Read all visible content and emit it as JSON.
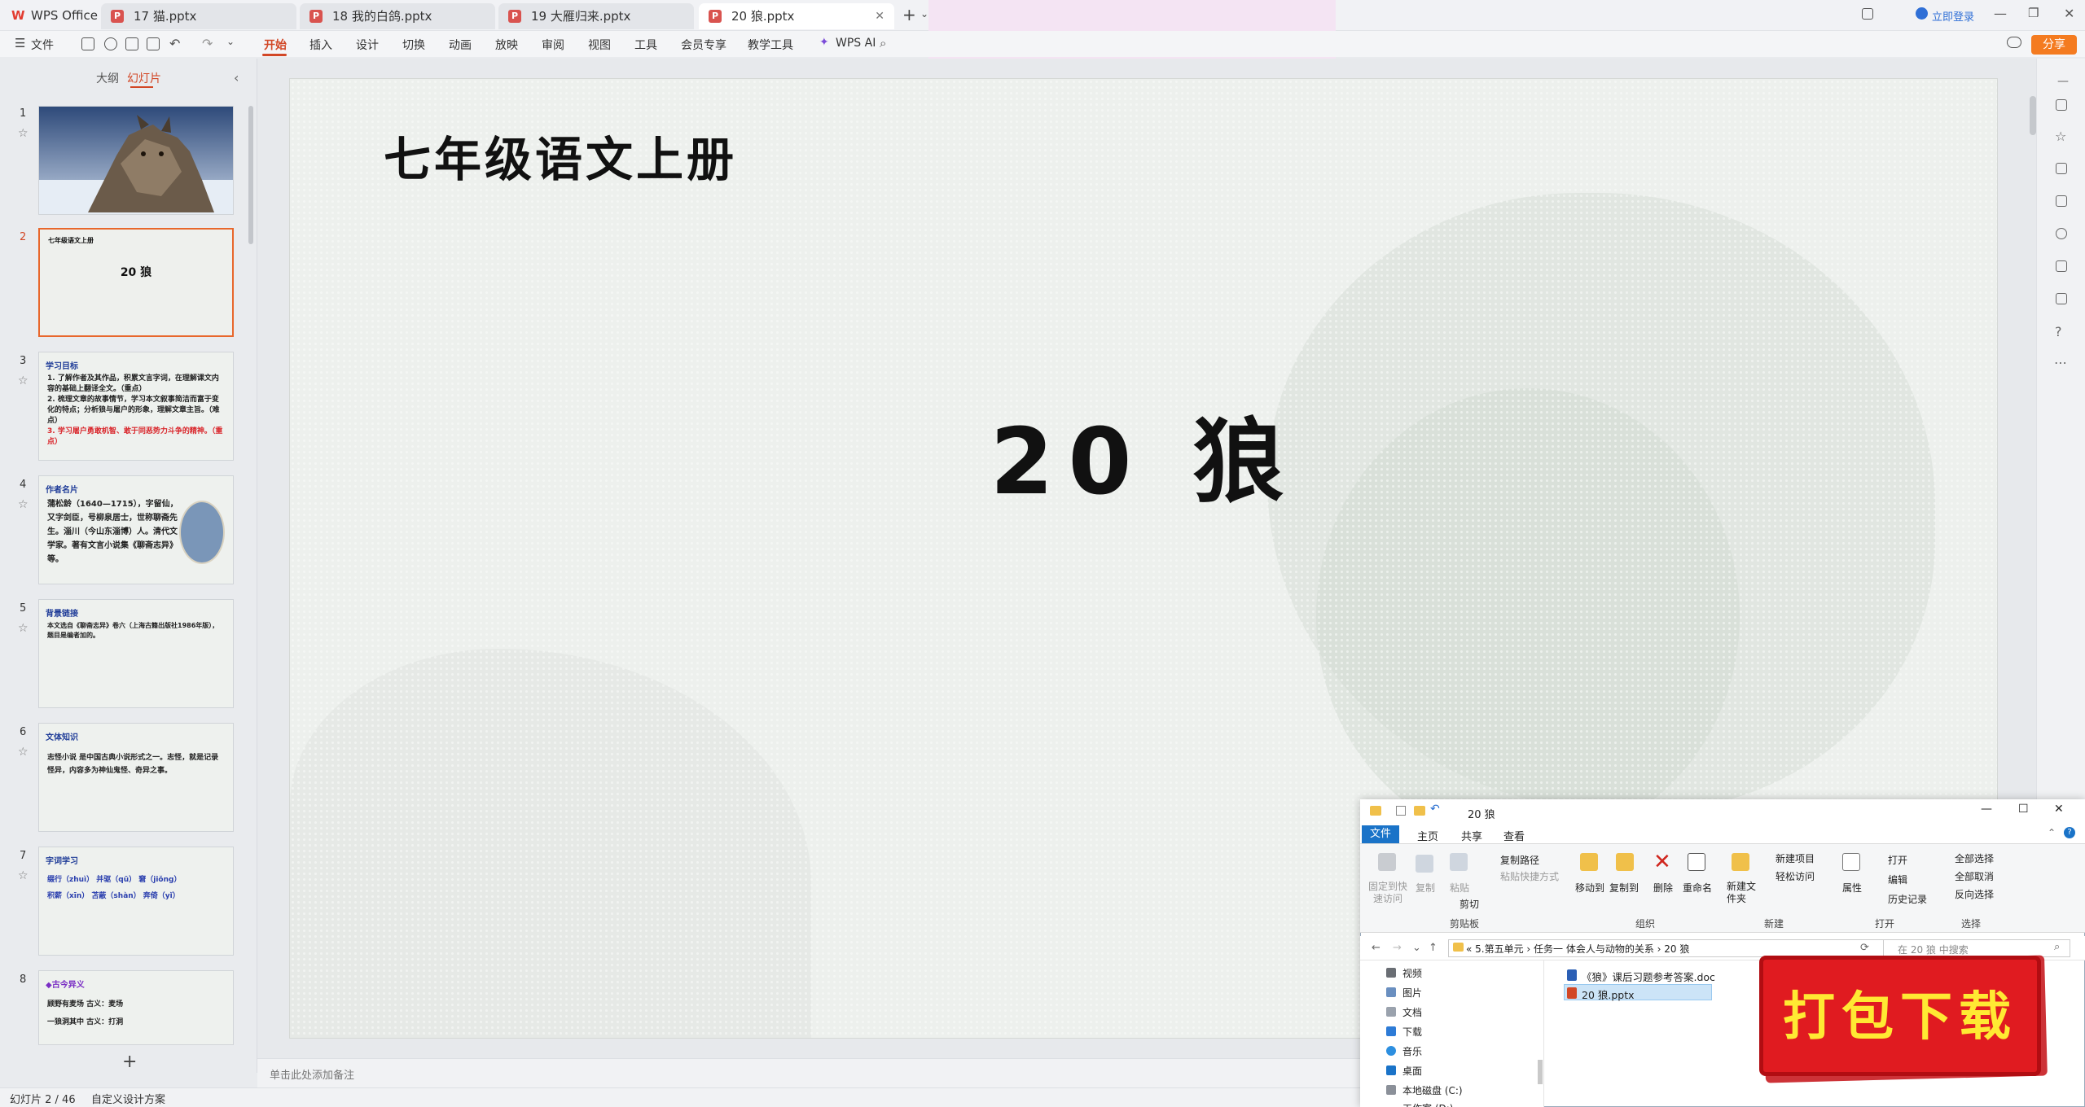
{
  "app": {
    "name": "WPS Office"
  },
  "tabs": [
    {
      "label": "17 猫.pptx"
    },
    {
      "label": "18 我的白鸽.pptx"
    },
    {
      "label": "19 大雁归来.pptx"
    },
    {
      "label": "20 狼.pptx"
    }
  ],
  "titlebar": {
    "login": "立即登录",
    "new_tab": "+"
  },
  "menu": {
    "file": "文件",
    "items": [
      "开始",
      "插入",
      "设计",
      "切换",
      "动画",
      "放映",
      "审阅",
      "视图",
      "工具",
      "会员专享",
      "教学工具"
    ],
    "wps_ai": "WPS AI",
    "share": "分享"
  },
  "panel": {
    "outline": "大纲",
    "slides": "幻灯片",
    "add": "+"
  },
  "thumbs": [
    {
      "num": "1"
    },
    {
      "num": "2",
      "title": "七年级语文上册",
      "main": "20 狼"
    },
    {
      "num": "3",
      "head": "学习目标",
      "lines": [
        "1. 了解作者及其作品，积累文言字词，在理解课文内容的基础上翻译全文。（重点）",
        "2. 梳理文章的故事情节，学习本文叙事简洁而富于变化的特点；分析狼与屠户的形象，理解文章主旨。（难点）",
        "3. 学习屠户勇敢机智、敢于同恶势力斗争的精神。（重点）"
      ]
    },
    {
      "num": "4",
      "head": "作者名片",
      "lines": [
        "蒲松龄（1640—1715），字留仙，又字剑臣，号柳泉居士，世称聊斋先生。淄川（今山东淄博）人。清代文学家。著有文言小说集《聊斋志异》等。"
      ]
    },
    {
      "num": "5",
      "head": "背景链接",
      "lines": [
        "本文选自《聊斋志异》卷六（上海古籍出版社1986年版），题目是编者加的。"
      ]
    },
    {
      "num": "6",
      "head": "文体知识",
      "lines": [
        "志怪小说 是中国古典小说形式之一。志怪，就是记录怪异，内容多为神仙鬼怪、奇异之事。"
      ]
    },
    {
      "num": "7",
      "head": "字词学习",
      "lines": [
        "缀行（zhuì） 并驱（qū） 窘（jiǒng）",
        "积薪（xīn） 苫蔽（shàn） 奔倚（yǐ）"
      ]
    },
    {
      "num": "8",
      "head": "◆古今异义",
      "lines": [
        "顾野有麦场 古义：麦场",
        "一狼洞其中 古义：打洞"
      ]
    }
  ],
  "slide": {
    "title": "七年级语文上册",
    "main": "20 狼"
  },
  "notes": {
    "placeholder": "单击此处添加备注"
  },
  "status": {
    "slide": "幻灯片 2 / 46",
    "design": "自定义设计方案"
  },
  "explorer": {
    "title": "20 狼",
    "tabs": {
      "file": "文件",
      "home": "主页",
      "share": "共享",
      "view": "查看"
    },
    "ribbon": {
      "pin": "固定到快速访问",
      "copy": "复制",
      "paste": "粘贴",
      "copy_path": "复制路径",
      "paste_shortcut": "粘贴快捷方式",
      "cut": "剪切",
      "move_to": "移动到",
      "copy_to": "复制到",
      "delete": "删除",
      "rename": "重命名",
      "new_folder": "新建文件夹",
      "new_item": "新建项目",
      "easy_access": "轻松访问",
      "properties": "属性",
      "open": "打开",
      "edit": "编辑",
      "history": "历史记录",
      "select_all": "全部选择",
      "select_none": "全部取消",
      "invert": "反向选择"
    },
    "groups": {
      "clipboard": "剪贴板",
      "organize": "组织",
      "new": "新建",
      "open": "打开",
      "select": "选择"
    },
    "address": "«  5.第五单元  ›  任务一 体会人与动物的关系  ›  20 狼",
    "search_placeholder": "在 20 狼 中搜索",
    "nav": [
      "视频",
      "图片",
      "文档",
      "下载",
      "音乐",
      "桌面",
      "本地磁盘 (C:)",
      "工作室 (D:)"
    ],
    "files": [
      "《狼》课后习题参考答案.doc",
      "20 狼.pptx"
    ]
  },
  "download_badge": {
    "text": "打包下载"
  }
}
